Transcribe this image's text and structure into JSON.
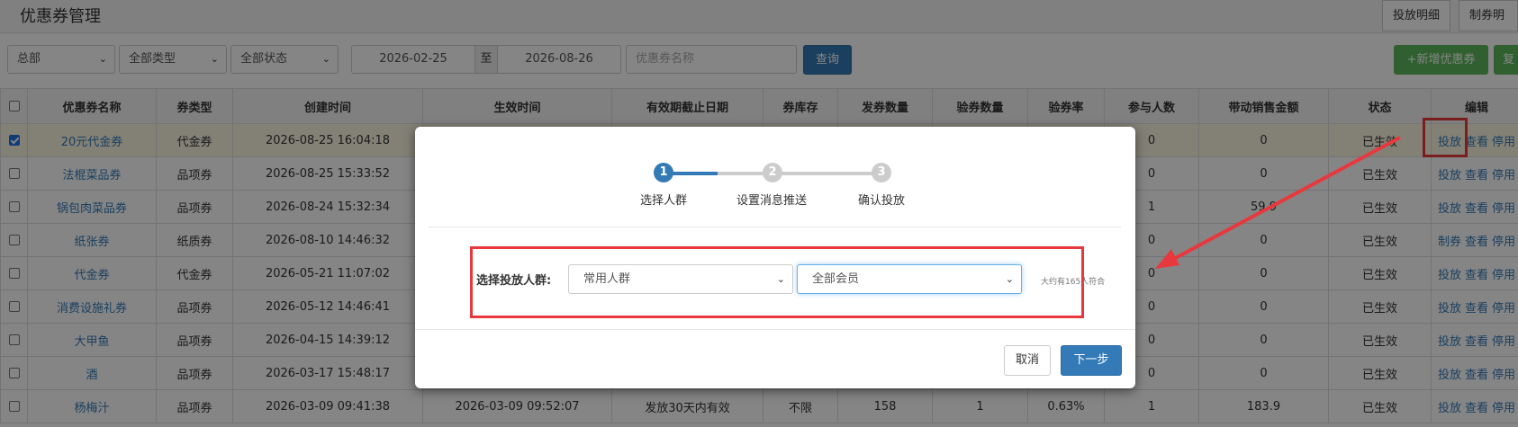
{
  "header": {
    "title": "优惠券管理",
    "tabs": [
      "投放明细",
      "制券明细"
    ]
  },
  "filters": {
    "store": "总部",
    "type": "全部类型",
    "status": "全部状态",
    "date_from": "2026-02-25",
    "date_sep": "至",
    "date_to": "2026-08-26",
    "name_placeholder": "优惠券名称",
    "query_label": "查询",
    "add_label": "+新增优惠券",
    "copy_label": "复"
  },
  "table": {
    "columns": [
      "优惠券名称",
      "券类型",
      "创建时间",
      "生效时间",
      "有效期截止日期",
      "券库存",
      "发券数量",
      "验券数量",
      "验券率",
      "参与人数",
      "带动销售金额",
      "状态",
      "编辑"
    ],
    "rows": [
      {
        "checked": true,
        "name": "20元代金券",
        "type": "代金券",
        "created": "2026-08-25 16:04:18",
        "effective": "",
        "expiry": "",
        "stock": "",
        "issued": "",
        "verified": "",
        "rate": "",
        "participants": "0",
        "sales": "0",
        "status": "已生效",
        "ops": [
          "投放",
          "查看",
          "停用"
        ]
      },
      {
        "checked": false,
        "name": "法棍菜品券",
        "type": "品项券",
        "created": "2026-08-25 15:33:52",
        "effective": "",
        "expiry": "",
        "stock": "",
        "issued": "",
        "verified": "",
        "rate": "",
        "participants": "0",
        "sales": "0",
        "status": "已生效",
        "ops": [
          "投放",
          "查看",
          "停用"
        ]
      },
      {
        "checked": false,
        "name": "锅包肉菜品券",
        "type": "品项券",
        "created": "2026-08-24 15:32:34",
        "effective": "",
        "expiry": "",
        "stock": "",
        "issued": "",
        "verified": "",
        "rate": "",
        "participants": "1",
        "sales": "59.9",
        "status": "已生效",
        "ops": [
          "投放",
          "查看",
          "停用"
        ]
      },
      {
        "checked": false,
        "name": "纸张券",
        "type": "纸质券",
        "created": "2026-08-10 14:46:32",
        "effective": "",
        "expiry": "",
        "stock": "",
        "issued": "",
        "verified": "",
        "rate": "",
        "participants": "0",
        "sales": "0",
        "status": "已生效",
        "ops": [
          "制券",
          "查看",
          "停用"
        ]
      },
      {
        "checked": false,
        "name": "代金券",
        "type": "代金券",
        "created": "2026-05-21 11:07:02",
        "effective": "",
        "expiry": "",
        "stock": "",
        "issued": "",
        "verified": "",
        "rate": "",
        "participants": "0",
        "sales": "0",
        "status": "已生效",
        "ops": [
          "投放",
          "查看",
          "停用"
        ]
      },
      {
        "checked": false,
        "name": "消费设施礼券",
        "type": "品项券",
        "created": "2026-05-12 14:46:41",
        "effective": "",
        "expiry": "",
        "stock": "",
        "issued": "",
        "verified": "",
        "rate": "",
        "participants": "0",
        "sales": "0",
        "status": "已生效",
        "ops": [
          "投放",
          "查看",
          "停用"
        ]
      },
      {
        "checked": false,
        "name": "大甲鱼",
        "type": "品项券",
        "created": "2026-04-15 14:39:12",
        "effective": "",
        "expiry": "",
        "stock": "",
        "issued": "",
        "verified": "",
        "rate": "",
        "participants": "0",
        "sales": "0",
        "status": "已生效",
        "ops": [
          "投放",
          "查看",
          "停用"
        ]
      },
      {
        "checked": false,
        "name": "酒",
        "type": "品项券",
        "created": "2026-03-17 15:48:17",
        "effective": "",
        "expiry": "",
        "stock": "",
        "issued": "",
        "verified": "",
        "rate": "",
        "participants": "0",
        "sales": "0",
        "status": "已生效",
        "ops": [
          "投放",
          "查看",
          "停用"
        ]
      },
      {
        "checked": false,
        "name": "杨梅汁",
        "type": "品项券",
        "created": "2026-03-09 09:41:38",
        "effective": "2026-03-09 09:52:07",
        "expiry": "发放30天内有效",
        "stock": "不限",
        "issued": "158",
        "verified": "1",
        "rate": "0.63%",
        "participants": "1",
        "sales": "183.9",
        "status": "已生效",
        "ops": [
          "投放",
          "查看",
          "停用"
        ]
      }
    ]
  },
  "modal": {
    "steps": [
      {
        "num": "1",
        "label": "选择人群"
      },
      {
        "num": "2",
        "label": "设置消息推送"
      },
      {
        "num": "3",
        "label": "确认投放"
      }
    ],
    "form_label": "选择投放人群:",
    "group_select": "常用人群",
    "member_select": "全部会员",
    "hint": "大约有165人符合",
    "cancel_label": "取消",
    "next_label": "下一步"
  },
  "colors": {
    "primary": "#337ab7",
    "success": "#5cb85c",
    "highlight": "#e8383d",
    "step_active": "#337ab7",
    "step_inactive": "#cccccc"
  }
}
